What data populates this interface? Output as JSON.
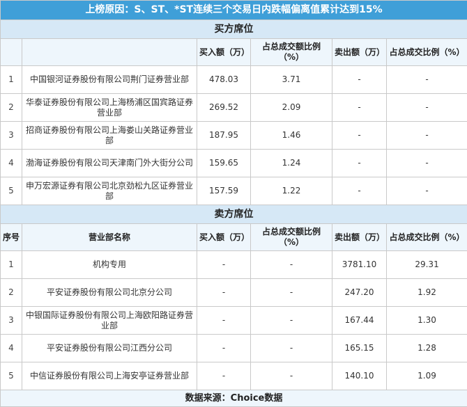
{
  "title": "上榜原因：S、ST、*ST连续三个交易日内跌幅偏离值累计达到15%",
  "buy": {
    "section_label": "买方席位",
    "header": {
      "seq": "",
      "name": "",
      "buy_amount": "买入额（万）",
      "buy_pct": "占总成交额比例（%）",
      "sell_amount": "卖出额（万）",
      "sell_pct": "占总成交比例（%）"
    },
    "rows": [
      {
        "seq": "1",
        "name": "中国银河证券股份有限公司荆门证券营业部",
        "buy_amount": "478.03",
        "buy_pct": "3.71",
        "sell_amount": "-",
        "sell_pct": "-"
      },
      {
        "seq": "2",
        "name": "华泰证券股份有限公司上海杨浦区国宾路证券营业部",
        "buy_amount": "269.52",
        "buy_pct": "2.09",
        "sell_amount": "-",
        "sell_pct": "-"
      },
      {
        "seq": "3",
        "name": "招商证券股份有限公司上海娄山关路证券营业部",
        "buy_amount": "187.95",
        "buy_pct": "1.46",
        "sell_amount": "-",
        "sell_pct": "-"
      },
      {
        "seq": "4",
        "name": "渤海证券股份有限公司天津南门外大街分公司",
        "buy_amount": "159.65",
        "buy_pct": "1.24",
        "sell_amount": "-",
        "sell_pct": "-"
      },
      {
        "seq": "5",
        "name": "申万宏源证券有限公司北京劲松九区证券营业部",
        "buy_amount": "157.59",
        "buy_pct": "1.22",
        "sell_amount": "-",
        "sell_pct": "-"
      }
    ]
  },
  "sell": {
    "section_label": "卖方席位",
    "header": {
      "seq": "序号",
      "name": "营业部名称",
      "buy_amount": "买入额（万）",
      "buy_pct": "占总成交额比例（%）",
      "sell_amount": "卖出额（万）",
      "sell_pct": "占总成交比例（%）"
    },
    "rows": [
      {
        "seq": "1",
        "name": "机构专用",
        "buy_amount": "-",
        "buy_pct": "-",
        "sell_amount": "3781.10",
        "sell_pct": "29.31"
      },
      {
        "seq": "2",
        "name": "平安证券股份有限公司北京分公司",
        "buy_amount": "-",
        "buy_pct": "-",
        "sell_amount": "247.20",
        "sell_pct": "1.92"
      },
      {
        "seq": "3",
        "name": "中银国际证券股份有限公司上海欧阳路证券营业部",
        "buy_amount": "-",
        "buy_pct": "-",
        "sell_amount": "167.44",
        "sell_pct": "1.30"
      },
      {
        "seq": "4",
        "name": "平安证券股份有限公司江西分公司",
        "buy_amount": "-",
        "buy_pct": "-",
        "sell_amount": "165.15",
        "sell_pct": "1.28"
      },
      {
        "seq": "5",
        "name": "中信证券股份有限公司上海安亭证券营业部",
        "buy_amount": "-",
        "buy_pct": "-",
        "sell_amount": "140.10",
        "sell_pct": "1.09"
      }
    ]
  },
  "footer": "数据来源：Choice数据",
  "colors": {
    "title_bg": "#3f9fd8",
    "section_bg": "#d6e8f6",
    "header_bg": "#eef6fc",
    "border": "#c9c9c9"
  }
}
